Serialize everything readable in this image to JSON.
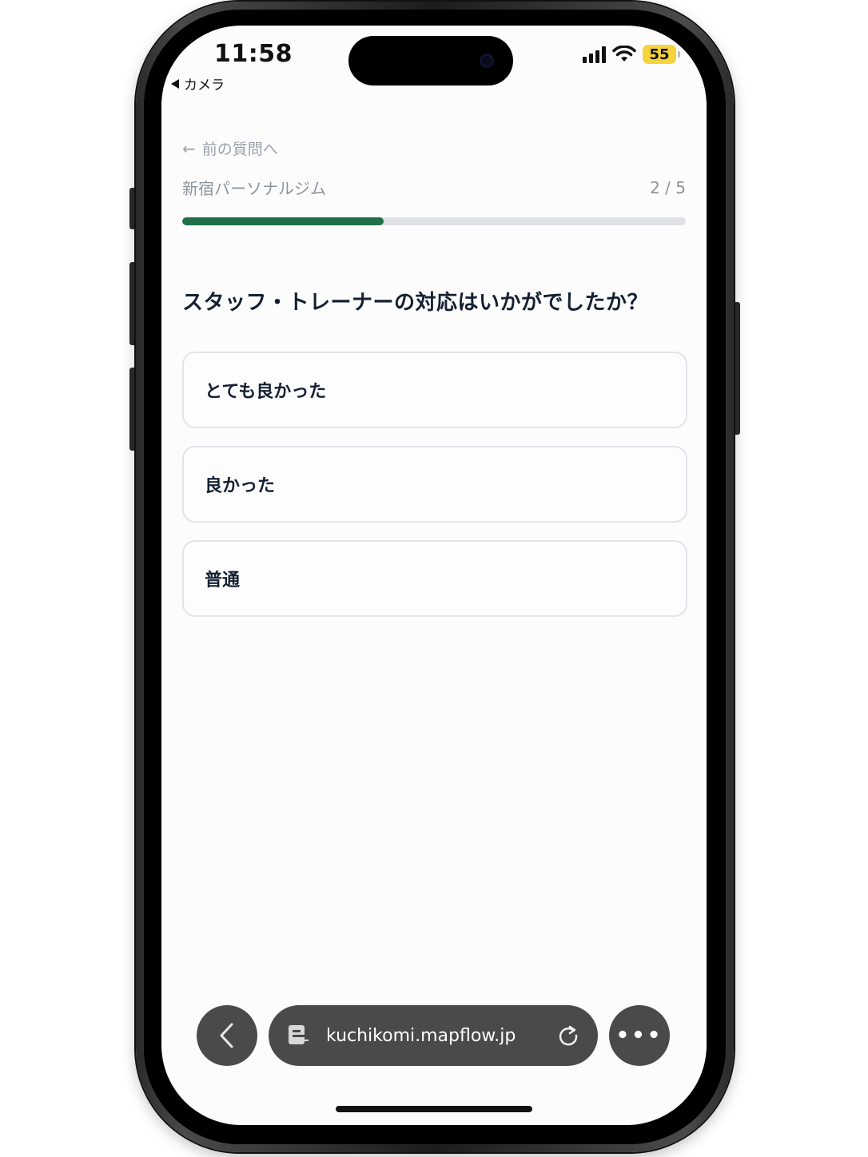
{
  "status_bar": {
    "time": "11:58",
    "back_app": "カメラ",
    "battery": "55",
    "icons": [
      "signal-icon",
      "wifi-icon",
      "battery-icon"
    ]
  },
  "nav": {
    "prev_label": "前の質問へ"
  },
  "survey": {
    "shop_name": "新宿パーソナルジム",
    "step_text": "2 / 5",
    "progress_fraction": 0.4,
    "question": "スタッフ・トレーナーの対応はいかがでしたか？",
    "options": [
      "とても良かった",
      "良かった",
      "普通"
    ]
  },
  "browser": {
    "url": "kuchikomi.mapflow.jp",
    "more": "•••"
  },
  "colors": {
    "progress_fill": "#1f6f48",
    "progress_track": "#dfe1e5",
    "battery": "#f6d33b",
    "toolbar": "#4a4a4a"
  }
}
